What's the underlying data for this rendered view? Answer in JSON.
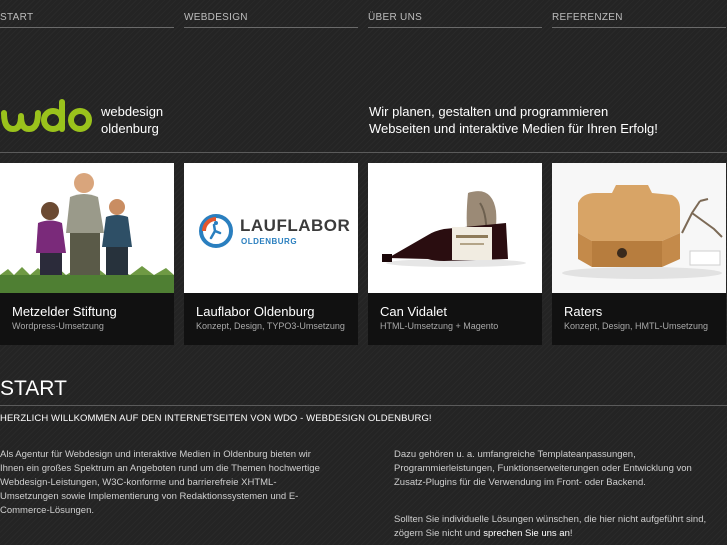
{
  "nav": {
    "items": [
      {
        "label": "START"
      },
      {
        "label": "WEBDESIGN"
      },
      {
        "label": "ÜBER UNS"
      },
      {
        "label": "REFERENZEN"
      }
    ]
  },
  "brand": {
    "line1": "webdesign",
    "line2": "oldenburg",
    "logo_color": "#9ac21c"
  },
  "tagline": {
    "line1": "Wir planen, gestalten und programmieren",
    "line2": "Webseiten und interaktive Medien für Ihren Erfolg!"
  },
  "references": [
    {
      "title": "Metzelder Stiftung",
      "subtitle": "Wordpress-Umsetzung"
    },
    {
      "title": "Lauflabor Oldenburg",
      "subtitle": "Konzept, Design, TYPO3-Umsetzung",
      "logo_text": "LAUFLABOR",
      "logo_subtext": "OLDENBURG"
    },
    {
      "title": "Can Vidalet",
      "subtitle": "HTML-Umsetzung + Magento"
    },
    {
      "title": "Raters",
      "subtitle": "Konzept, Design, HMTL-Umsetzung"
    }
  ],
  "content": {
    "heading": "START",
    "welcome": "HERZLICH WILLKOMMEN AUF DEN INTERNETSEITEN VON WDO - WEBDESIGN OLDENBURG!",
    "col1_lines": [
      "Als Agentur für Webdesign und interaktive Medien in Oldenburg bieten wir",
      "Ihnen ein großes Spektrum an Angeboten rund um die Themen hochwertige",
      "Webdesign-Leistungen, W3C-konforme und barrierefreie XHTML-",
      "Umsetzungen sowie Implementierung von Redaktionssystemen und E-",
      "Commerce-Lösungen."
    ],
    "col2_lines": [
      "Dazu gehören u. a. umfangreiche Templateanpassungen,",
      "Programmierleistungen, Funktionserweiterungen oder Entwicklung von",
      "Zusatz-Plugins für die Verwendung im Front- oder Backend."
    ],
    "col2b_line1": "Sollten Sie individuelle Lösungen wünschen, die hier nicht aufgeführt sind,",
    "col2b_line2_prefix": "zögern Sie nicht und ",
    "col2b_link": "sprechen Sie uns an",
    "col2b_line2_suffix": "!"
  }
}
